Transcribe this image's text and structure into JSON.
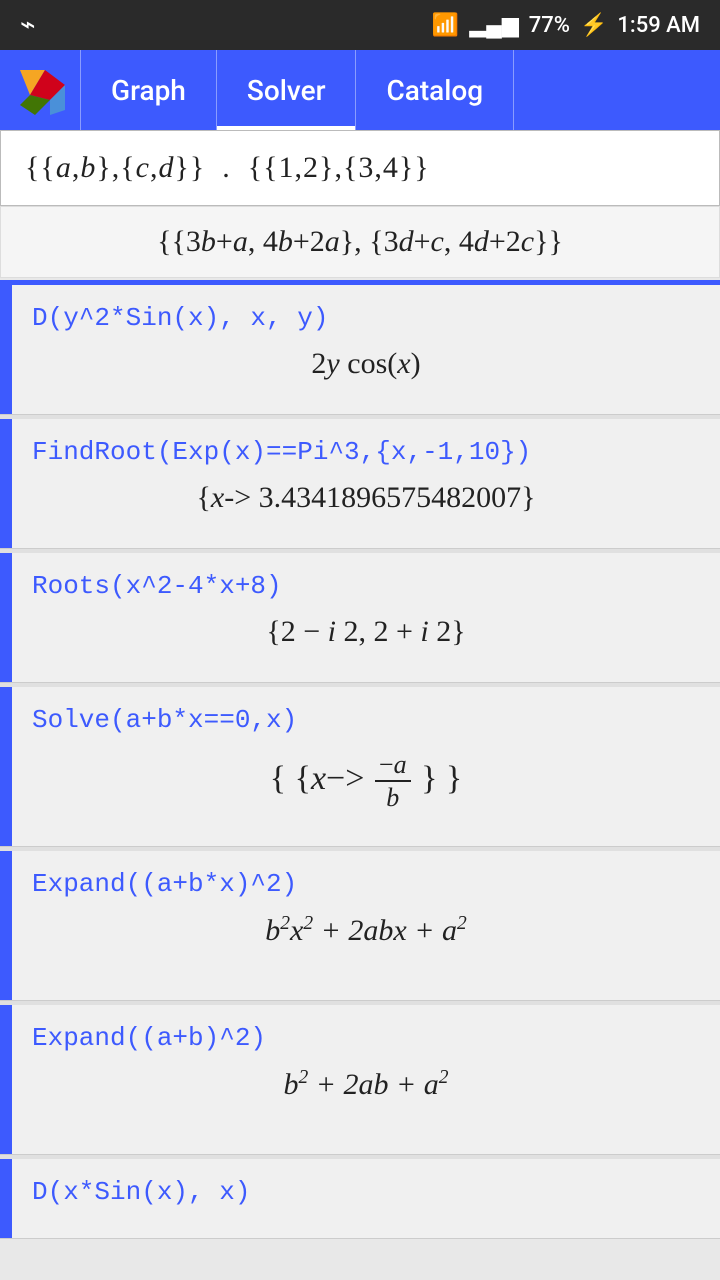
{
  "statusBar": {
    "battery": "77%",
    "time": "1:59 AM",
    "signal": "WiFi + Cell"
  },
  "header": {
    "tabs": [
      {
        "label": "Graph",
        "active": false
      },
      {
        "label": "Solver",
        "active": true
      },
      {
        "label": "Catalog",
        "active": false
      }
    ]
  },
  "inputBar": {
    "value": "{{a,b},{c,d}} . {{1,2},{3,4}}"
  },
  "resultBar": {
    "value": "{{3b+a, 4b+2a}, {3d+c, 4d+2c}}"
  },
  "historyItems": [
    {
      "input": "D(y^2*Sin(x), x, y)",
      "output": "2y cos(x)"
    },
    {
      "input": "FindRoot(Exp(x)==Pi^3,{x,-1,10})",
      "output": "{x-> 3.43418965754820​07}"
    },
    {
      "input": "Roots(x^2-4*x+8)",
      "output": "{2 - i 2, 2 + i 2}"
    },
    {
      "input": "Solve(a+b*x==0,x)",
      "output": "fraction",
      "outputFrac": true
    },
    {
      "input": "Expand((a+b*x)^2)",
      "output": "b²x² + 2abx + a²",
      "outputMath": true
    },
    {
      "input": "Expand((a+b)^2)",
      "output": "b² + 2ab + a²",
      "outputMath": true
    },
    {
      "input": "D(x*Sin(x), x)",
      "output": "",
      "partial": true
    }
  ],
  "labels": {
    "graph": "Graph",
    "solver": "Solver",
    "catalog": "Catalog"
  }
}
